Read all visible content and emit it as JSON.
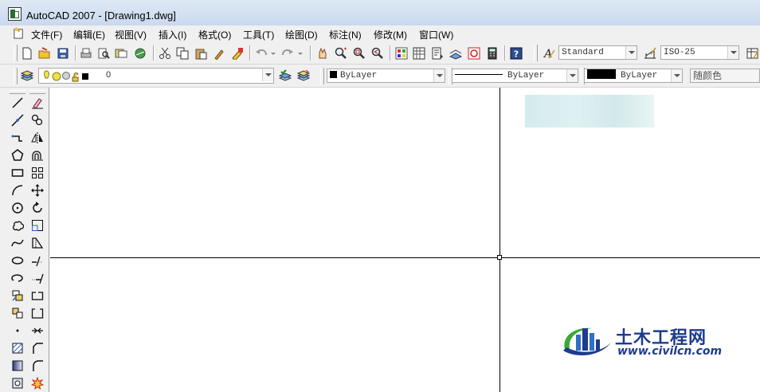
{
  "window": {
    "title": "AutoCAD 2007 - [Drawing1.dwg]"
  },
  "menu": {
    "items": [
      "文件(F)",
      "编辑(E)",
      "视图(V)",
      "插入(I)",
      "格式(O)",
      "工具(T)",
      "绘图(D)",
      "标注(N)",
      "修改(M)",
      "窗口(W)"
    ]
  },
  "styles_toolbar": {
    "text_style": "Standard",
    "dim_style": "ISO-25"
  },
  "layers_toolbar": {
    "current_layer": "0"
  },
  "properties_toolbar": {
    "color": "ByLayer",
    "linetype": "ByLayer",
    "lineweight": "ByLayer",
    "plot_style": "随颜色"
  },
  "colors": {
    "title_bar": "#c9d9ee",
    "toolbar_bg": "#f0f0f0",
    "watermark_blue": "#1e3b8c",
    "watermark_green": "#3aa935"
  },
  "watermark": {
    "cn": "土木工程网",
    "url": "www.civilcn.com"
  }
}
